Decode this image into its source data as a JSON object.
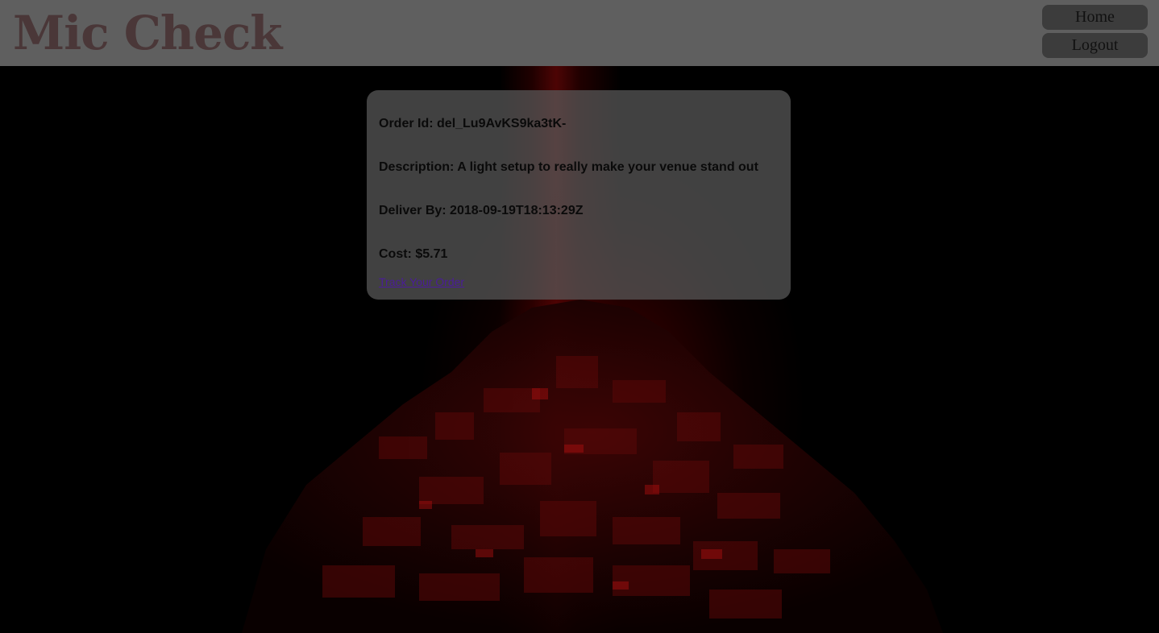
{
  "header": {
    "title": "Mic Check",
    "nav": {
      "home_label": "Home",
      "logout_label": "Logout"
    }
  },
  "order": {
    "id_label": "Order Id:",
    "id_value": "del_Lu9AvKS9ka3tK-",
    "description_label": "Description:",
    "description_value": "A light setup to really make your venue stand out",
    "deliver_by_label": "Deliver By:",
    "deliver_by_value": "2018-09-19T18:13:29Z",
    "cost_label": "Cost:",
    "cost_value": "$5.71",
    "track_link_label": "Track Your Order"
  },
  "colors": {
    "header_bg": "#5f5f5f",
    "title_color": "#4a3738",
    "nav_button_bg": "#3c3c3c",
    "card_bg": "#5a5a5a",
    "link_color": "#4b1c9a",
    "accent_red": "#aa0a0a"
  }
}
